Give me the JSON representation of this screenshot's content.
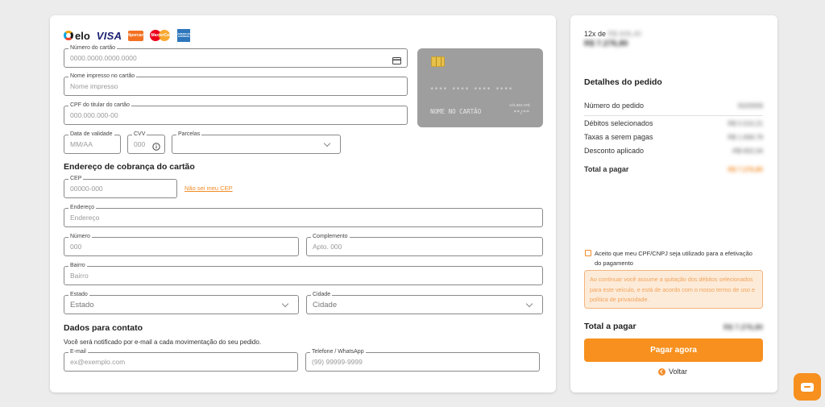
{
  "brands": {
    "elo": "elo",
    "visa": "VISA",
    "hipercard": "Hipercard",
    "mastercard": "MasterCard",
    "amex": "AMERICAN EXPRESS"
  },
  "card_form": {
    "numero": {
      "label": "Número do cartão",
      "placeholder": "0000.0000.0000.0000"
    },
    "nome": {
      "label": "Nome impresso no cartão",
      "placeholder": "Nome impresso"
    },
    "cpf": {
      "label": "CPF do titular do cartão",
      "placeholder": "000.000.000-00"
    },
    "validade": {
      "label": "Data de validade",
      "placeholder": "MM/AA"
    },
    "cvv": {
      "label": "CVV",
      "placeholder": "000"
    },
    "parcelas": {
      "label": "Parcelas",
      "value": ""
    }
  },
  "card_preview": {
    "number": "**** **** **** ****",
    "name": "NOME NO CARTÃO",
    "valid_label": "VÁLIDO ATÉ",
    "valid_value": "**/**"
  },
  "billing": {
    "title": "Endereço de cobrança do cartão",
    "cep": {
      "label": "CEP",
      "placeholder": "00000-000"
    },
    "cep_link": "Não sei meu CEP",
    "endereco": {
      "label": "Endereço",
      "placeholder": "Endereço"
    },
    "numero": {
      "label": "Número",
      "placeholder": "000"
    },
    "complemento": {
      "label": "Complemento",
      "placeholder": "Apto. 000"
    },
    "bairro": {
      "label": "Bairro",
      "placeholder": "Bairro"
    },
    "estado": {
      "label": "Estado",
      "value": "Estado"
    },
    "cidade": {
      "label": "Cidade",
      "value": "Cidade"
    }
  },
  "contact": {
    "title": "Dados para contato",
    "subtitle": "Você será notificado por e-mail a cada movimentação do seu pedido.",
    "email": {
      "label": "E-mail",
      "placeholder": "ex@exemplo.com"
    },
    "phone": {
      "label": "Telefone / WhatsApp",
      "placeholder": "(99) 99999-9999"
    }
  },
  "summary": {
    "installments_prefix": "12x de",
    "installments_value": "R$ 606,40",
    "total_top": "R$ 7.276,80",
    "details_title": "Detalhes do pedido",
    "order_number_label": "Número do pedido",
    "order_number_value": "5020059",
    "debits_label": "Débitos selecionados",
    "debits_value": "R$ 5.510,21",
    "fees_label": "Taxas a serem pagas",
    "fees_value": "R$ 1.658,79",
    "discount_label": "Desconto aplicado",
    "discount_value": "-R$ 602,04",
    "total_label": "Total a pagar",
    "total_value": "R$ 7.276,80",
    "accept_text": "Aceito que meu CPF/CNPJ seja utilizado para a efetivação do pagamento",
    "notice": "Ao continuar você assume a quitação dos débitos selecionados para este veículo, e está de acordo com o nosso termo de uso e política de privacidade.",
    "total_bottom_label": "Total a pagar",
    "total_bottom_value": "R$ 7.276,80",
    "pay_button": "Pagar agora",
    "back": "Voltar"
  },
  "colors": {
    "accent": "#f7901e",
    "card_bg": "#9e9e9e",
    "notice_bg": "#fdebd9"
  }
}
